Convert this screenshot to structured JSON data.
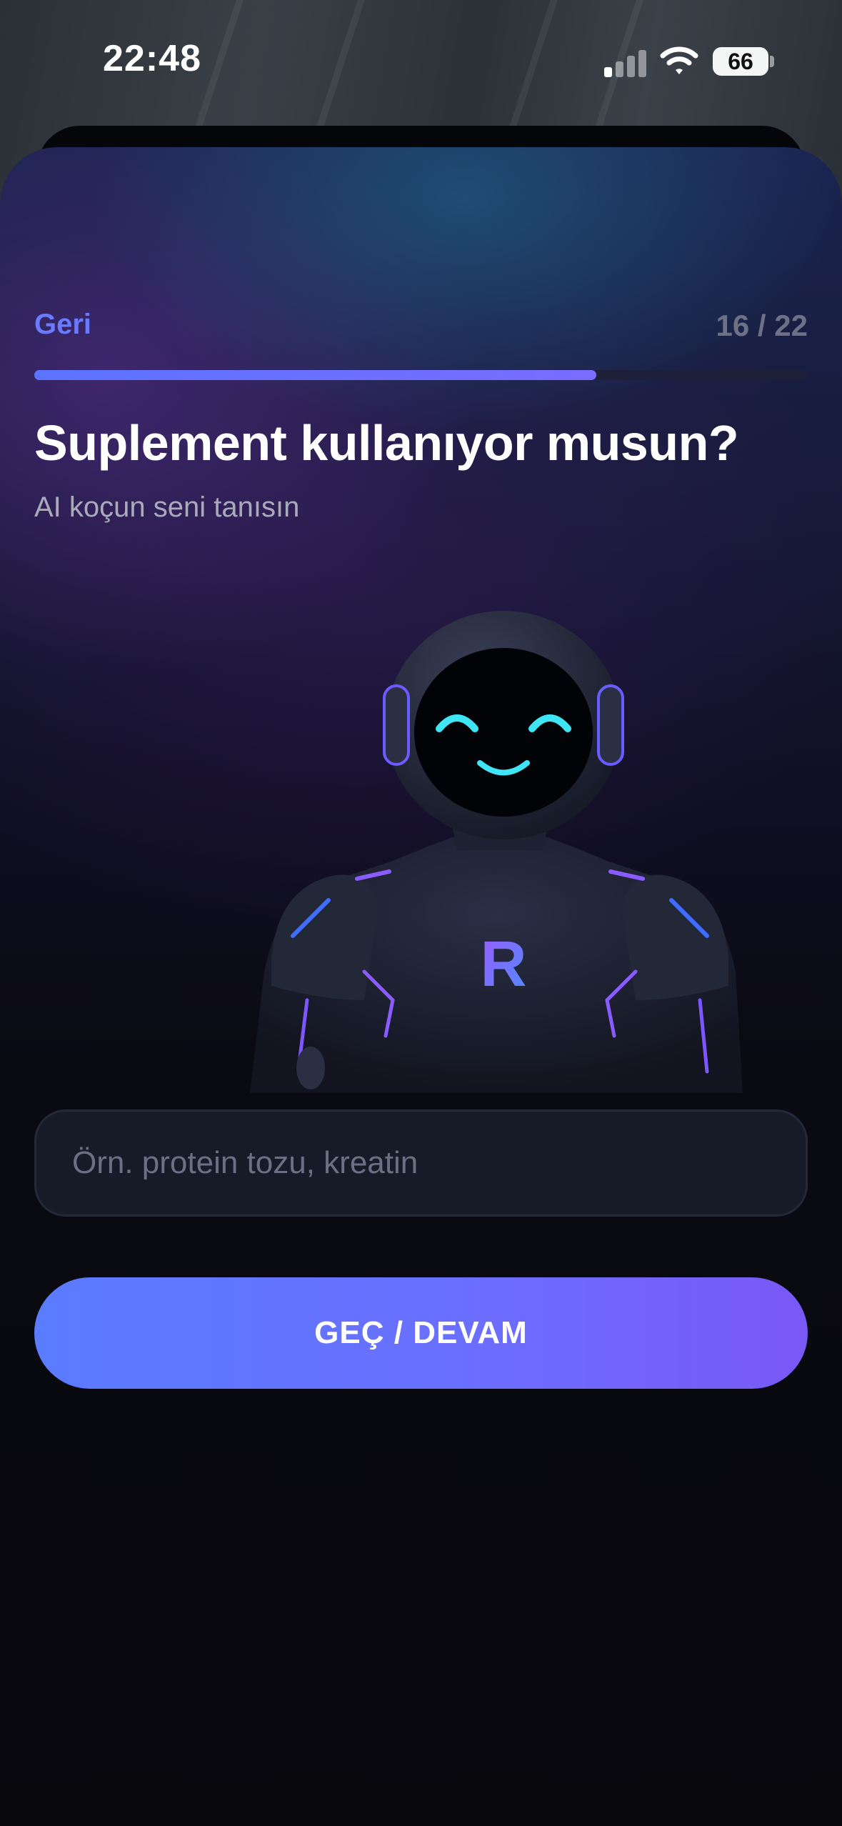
{
  "status_bar": {
    "time": "22:48",
    "battery": "66",
    "signal_bars_active": 1,
    "signal_bars_total": 4
  },
  "header": {
    "back_label": "Geri",
    "step": "16 / 22",
    "progress": 0.727
  },
  "question": {
    "title": "Suplement kullanıyor musun?",
    "subtitle": "AI koçun seni tanısın"
  },
  "mascot": {
    "logo_letter": "R"
  },
  "input": {
    "placeholder": "Örn. protein tozu, kreatin",
    "value": ""
  },
  "cta": {
    "label": "GEÇ / DEVAM"
  },
  "colors": {
    "accent": "#6b7bff",
    "cta_start": "#5a7cff",
    "cta_end": "#7a58f6",
    "face_glow": "#3ee6f5"
  },
  "icons": [
    "cellular-signal-icon",
    "wifi-icon",
    "battery-icon"
  ]
}
